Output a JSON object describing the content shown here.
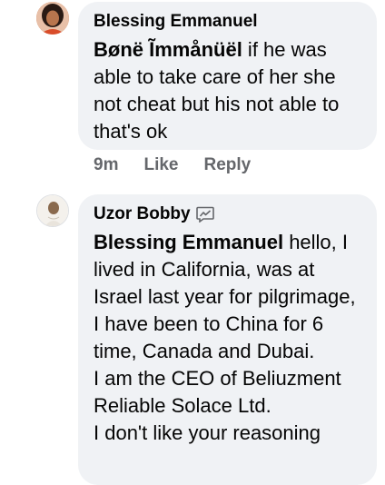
{
  "comments": [
    {
      "author": "Blessing Emmanuel",
      "tag": "Bønë Ĩmmånüël",
      "text": " if he was able to take care of her she not cheat but his not able to that's ok",
      "time": "9m",
      "like_label": "Like",
      "reply_label": "Reply"
    },
    {
      "author": "Uzor Bobby",
      "author_icon": "messenger-icon",
      "tag": "Blessing Emmanuel",
      "lines": [
        " hello, I lived in California, was at Israel last year for pilgrimage, I have been to China for 6 time, Canada and Dubai.",
        "I am the CEO of Beliuzment Reliable Solace Ltd.",
        "I don't like your reasoning"
      ]
    }
  ]
}
